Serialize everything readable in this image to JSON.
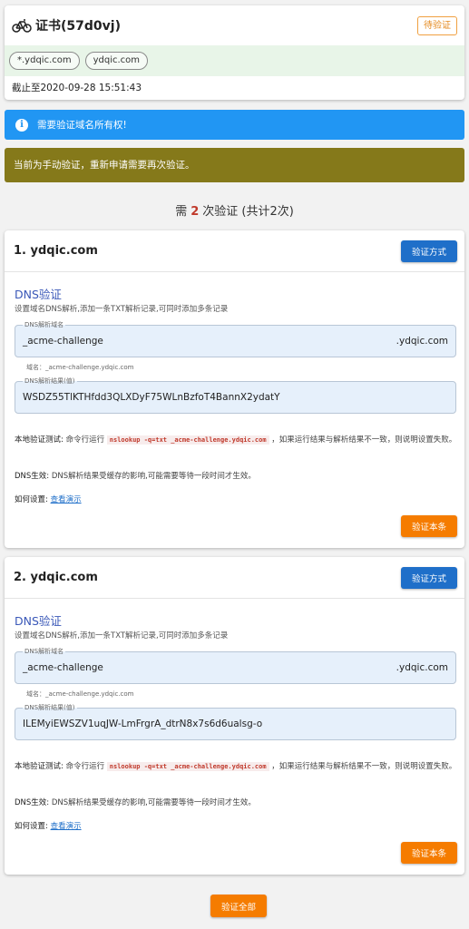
{
  "cert": {
    "icon": "bicycle-icon",
    "title": "证书(57d0vj)",
    "status": "待验证",
    "domains": [
      "*.ydqic.com",
      "ydqic.com"
    ],
    "expire": "截止至2020-09-28 15:51:43"
  },
  "alerts": {
    "info": "需要验证域名所有权!",
    "warn": "当前为手动验证，重新申请需要再次验证。"
  },
  "need": {
    "prefix": "需",
    "count": "2",
    "suffix": "次验证 (共计2次)"
  },
  "verifications": [
    {
      "title": "1.  ydqic.com",
      "method_button": "验证方式",
      "dns_title": "DNS验证",
      "dns_sub": "设置域名DNS解析,添加一条TXT解析记录,可同时添加多条记录",
      "name_label": "DNS解析域名",
      "name_value": "_acme-challenge",
      "name_suffix": ".ydqic.com",
      "name_hint": "域名：_acme-challenge.ydqic.com",
      "result_label": "DNS解析结果(值)",
      "result_value": "WSDZ55TlKTHfdd3QLXDyF75WLnBzfoT4BannX2ydatY",
      "test_key": "本地验证测试:",
      "test_pre": " 命令行运行 ",
      "test_cmd": "nslookup -q=txt _acme-challenge.ydqic.com",
      "test_post": " ，如果运行结果与解析结果不一致，则说明设置失败。",
      "effect_key": "DNS生效:",
      "effect_text": " DNS解析结果受缓存的影响,可能需要等待一段时间才生效。",
      "howto_key": "如何设置:",
      "howto_link": "查看演示",
      "verify_button": "验证本条"
    },
    {
      "title": "2.  ydqic.com",
      "method_button": "验证方式",
      "dns_title": "DNS验证",
      "dns_sub": "设置域名DNS解析,添加一条TXT解析记录,可同时添加多条记录",
      "name_label": "DNS解析域名",
      "name_value": "_acme-challenge",
      "name_suffix": ".ydqic.com",
      "name_hint": "域名：_acme-challenge.ydqic.com",
      "result_label": "DNS解析结果(值)",
      "result_value": "ILEMyiEWSZV1uqJW-LmFrgrA_dtrN8x7s6d6ualsg-o",
      "test_key": "本地验证测试:",
      "test_pre": " 命令行运行 ",
      "test_cmd": "nslookup -q=txt _acme-challenge.ydqic.com",
      "test_post": " ，如果运行结果与解析结果不一致，则说明设置失败。",
      "effect_key": "DNS生效:",
      "effect_text": " DNS解析结果受缓存的影响,可能需要等待一段时间才生效。",
      "howto_key": "如何设置:",
      "howto_link": "查看演示",
      "verify_button": "验证本条"
    }
  ],
  "verify_all": "验证全部"
}
